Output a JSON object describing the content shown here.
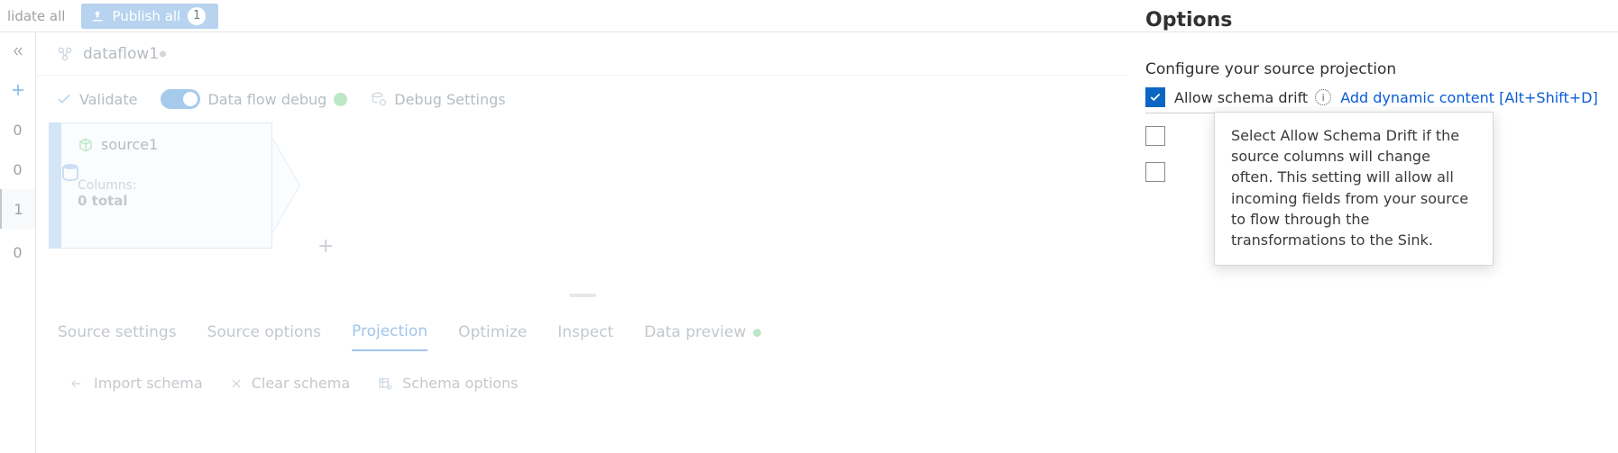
{
  "top": {
    "validate_all_truncated": "lidate all",
    "publish_all_label": "Publish all",
    "publish_count": "1"
  },
  "rail": {
    "n0a": "0",
    "n0b": "0",
    "n1": "1",
    "n0c": "0"
  },
  "tab": {
    "name": "dataflow1"
  },
  "cmd": {
    "validate": "Validate",
    "debug_label": "Data flow debug",
    "debug_settings": "Debug Settings"
  },
  "node": {
    "title": "source1",
    "cols_label": "Columns:",
    "total": "0 total"
  },
  "lower": {
    "tabs": {
      "source_settings": "Source settings",
      "source_options": "Source options",
      "projection": "Projection",
      "optimize": "Optimize",
      "inspect": "Inspect",
      "data_preview": "Data preview"
    },
    "actions": {
      "import_schema": "Import schema",
      "clear_schema": "Clear schema",
      "schema_options": "Schema options"
    }
  },
  "options": {
    "heading": "Options",
    "sub": "Configure your source projection",
    "allow_schema_drift": "Allow schema drift",
    "add_dynamic": "Add dynamic content [Alt+Shift+D]",
    "tooltip": "Select Allow Schema Drift if the source columns will change often. This setting will allow all incoming fields from your source to flow through the transformations to the Sink."
  }
}
